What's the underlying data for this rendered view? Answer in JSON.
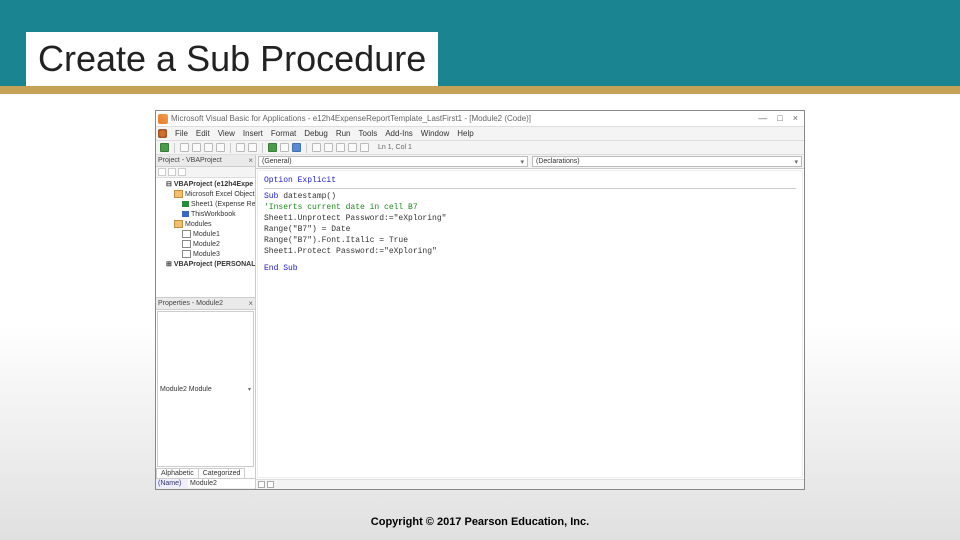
{
  "slide": {
    "title": "Create a Sub Procedure",
    "copyright": "Copyright © 2017 Pearson Education, Inc."
  },
  "vba": {
    "title": "Microsoft Visual Basic for Applications - e12h4ExpenseReportTemplate_LastFirst1 - [Module2 (Code)]",
    "menus": [
      "File",
      "Edit",
      "View",
      "Insert",
      "Format",
      "Debug",
      "Run",
      "Tools",
      "Add-Ins",
      "Window",
      "Help"
    ],
    "cursor": "Ln 1, Col 1",
    "project_panel_title": "Project - VBAProject",
    "projects": {
      "root": "VBAProject (e12h4Expe",
      "excel_objects": "Microsoft Excel Objects",
      "sheet": "Sheet1 (Expense Re",
      "workbook": "ThisWorkbook",
      "modules_folder": "Modules",
      "m1": "Module1",
      "m2": "Module2",
      "m3": "Module3",
      "personal": "VBAProject (PERSONAL."
    },
    "properties_panel_title": "Properties - Module2",
    "properties": {
      "module_combo": "Module2 Module",
      "tab1": "Alphabetic",
      "tab2": "Categorized",
      "name_key": "(Name)",
      "name_val": "Module2"
    },
    "code_combo_left": "(General)",
    "code_combo_right": "(Declarations)",
    "code": {
      "l1": "Option Explicit",
      "l2a": "Sub",
      "l2b": " datestamp()",
      "l3": "'Inserts current date in cell B7",
      "l4": "Sheet1.Unprotect Password:=\"eXploring\"",
      "l5": "Range(\"B7\") = Date",
      "l6": "Range(\"B7\").Font.Italic = True",
      "l7": "Sheet1.Protect Password:=\"eXploring\"",
      "l8": "End Sub"
    }
  }
}
